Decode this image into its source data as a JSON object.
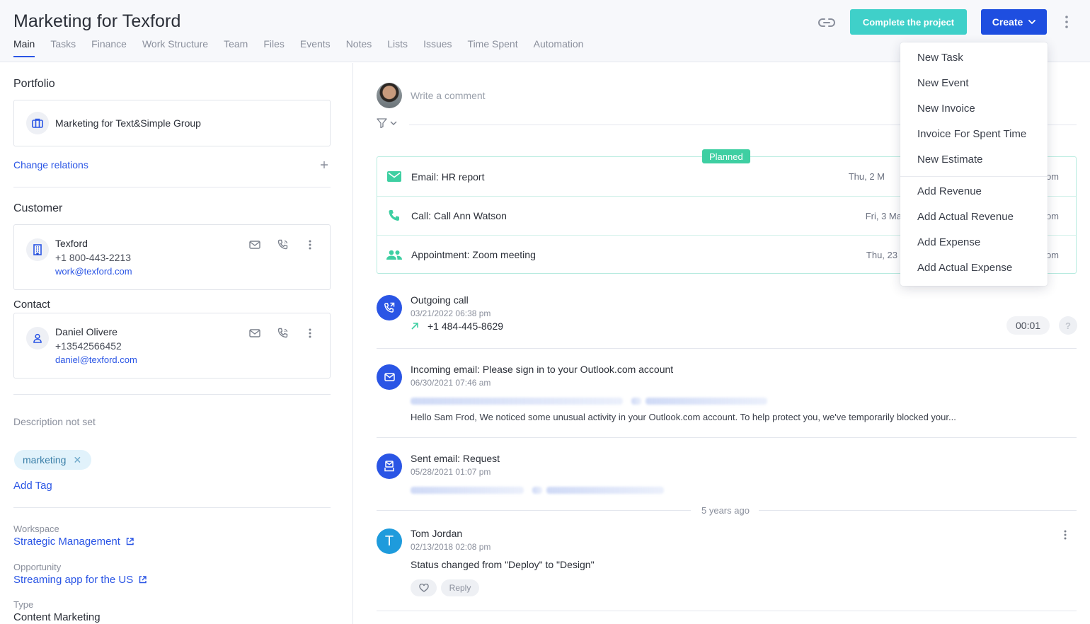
{
  "header": {
    "title": "Marketing for Texford",
    "tabs": [
      "Main",
      "Tasks",
      "Finance",
      "Work Structure",
      "Team",
      "Files",
      "Events",
      "Notes",
      "Lists",
      "Issues",
      "Time Spent",
      "Automation"
    ],
    "active_tab": "Main",
    "complete_label": "Complete the project",
    "create_label": "Create"
  },
  "create_menu": {
    "group1": [
      "New Task",
      "New Event",
      "New Invoice",
      "Invoice For Spent Time",
      "New Estimate"
    ],
    "group2": [
      "Add Revenue",
      "Add Actual Revenue",
      "Add Expense",
      "Add Actual Expense"
    ]
  },
  "left": {
    "portfolio_title": "Portfolio",
    "portfolio_name": "Marketing for Text&Simple Group",
    "change_relations": "Change relations",
    "customer_title": "Customer",
    "customer": {
      "name": "Texford",
      "phone": "+1 800-443-2213",
      "email": "work@texford.com"
    },
    "contact_title": "Contact",
    "contact": {
      "name": "Daniel Olivere",
      "phone": "+13542566452",
      "email": "daniel@texford.com"
    },
    "description": "Description not set",
    "tag": "marketing",
    "add_tag": "Add Tag",
    "workspace_label": "Workspace",
    "workspace_value": "Strategic Management",
    "opportunity_label": "Opportunity",
    "opportunity_value": "Streaming app for the US",
    "type_label": "Type",
    "type_value": "Content Marketing"
  },
  "feed": {
    "comment_placeholder": "Write a comment",
    "planned_label": "Planned",
    "planned": [
      {
        "label": "Email: HR report",
        "date": "Thu, 2 M",
        "time_suffix": "om"
      },
      {
        "label": "Call: Call Ann Watson",
        "date": "Fri, 3 Ma",
        "time_suffix": "om"
      },
      {
        "label": "Appointment: Zoom meeting",
        "date": "Thu, 23",
        "time_suffix": "om"
      }
    ],
    "outgoing_call": {
      "title": "Outgoing call",
      "date": "03/21/2022 06:38 pm",
      "number": "+1 484-445-8629",
      "duration": "00:01",
      "help": "?"
    },
    "incoming_email": {
      "title": "Incoming email: Please sign in to your Outlook.com account",
      "date": "06/30/2021 07:46 am",
      "preview": "Hello Sam Frod, We noticed some unusual activity in your Outlook.com account. To help protect you, we've temporarily blocked your..."
    },
    "sent_email": {
      "title": "Sent email: Request",
      "date": "05/28/2021 01:07 pm"
    },
    "time_separator": "5 years ago",
    "status_change": {
      "author": "Tom Jordan",
      "initial": "T",
      "date": "02/13/2018 02:08 pm",
      "text": "Status changed from \"Deploy\" to \"Design\"",
      "reply_label": "Reply"
    }
  },
  "colors": {
    "accent": "#1e4ee0",
    "complete": "#3fd0c9",
    "planned": "#3ecfa2",
    "link": "#2a55e5"
  }
}
